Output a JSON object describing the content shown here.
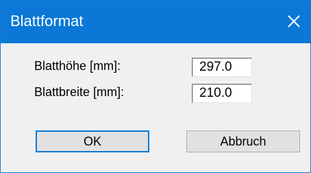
{
  "window": {
    "title": "Blattformat",
    "close_icon": "close-icon"
  },
  "fields": {
    "height_label": "Blatthöhe [mm]:",
    "height_value": "297.0",
    "width_label": "Blattbreite [mm]:",
    "width_value": "210.0"
  },
  "buttons": {
    "ok_label": "OK",
    "cancel_label": "Abbruch"
  },
  "colors": {
    "titlebar": "#0b78d7",
    "dialog_bg": "#f0f0f0"
  }
}
